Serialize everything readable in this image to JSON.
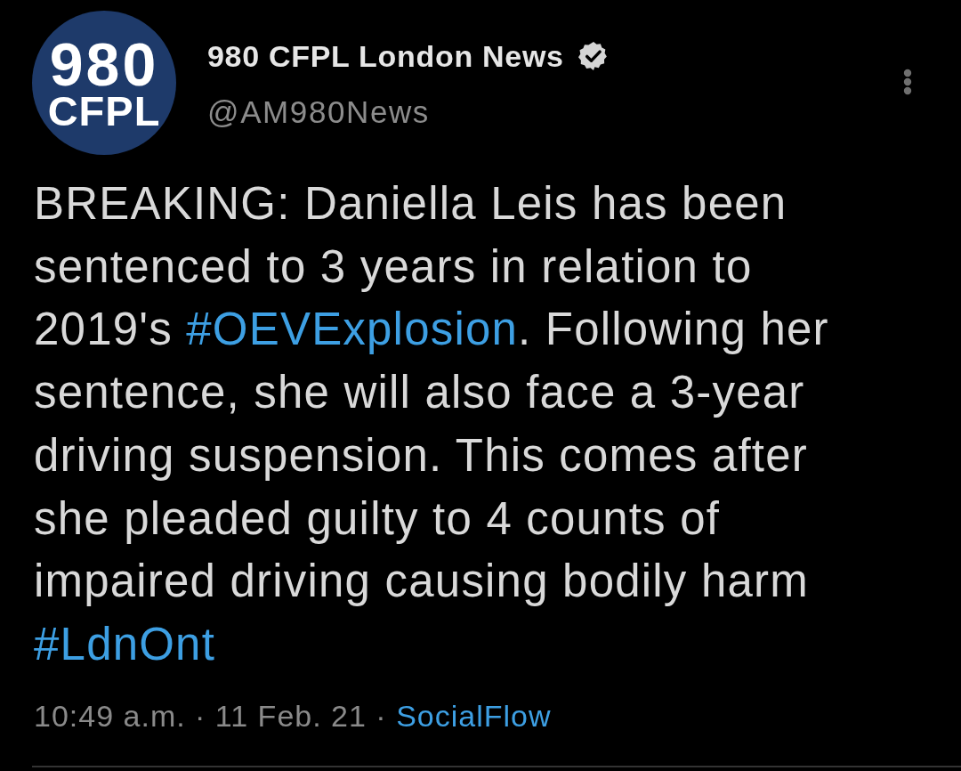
{
  "avatar": {
    "line_1": "980",
    "line_2": "CFPL"
  },
  "author": {
    "name": "980 CFPL London News",
    "verified": true,
    "handle": "@AM980News"
  },
  "body": [
    {
      "kind": "text",
      "text": "BREAKING: Daniella Leis has been sentenced to 3 years in relation to 2019's "
    },
    {
      "kind": "hashtag",
      "text": "#OEVExplosion"
    },
    {
      "kind": "text",
      "text": ". Following her sentence, she will also face a 3-year driving suspension. This comes after she pleaded guilty to 4 counts of impaired driving causing bodily harm "
    },
    {
      "kind": "hashtag",
      "text": "#LdnOnt"
    }
  ],
  "meta": {
    "timestamp": "10:49 a.m. · 11 Feb. 21 ·",
    "source": "SocialFlow"
  }
}
